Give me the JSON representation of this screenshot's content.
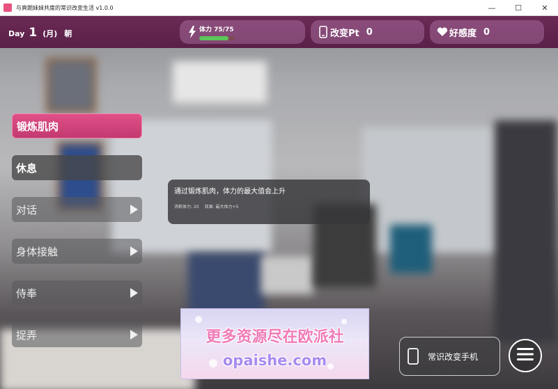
{
  "window": {
    "title": "与爽朗妹妹共度的常识改变生活 v1.0.0",
    "minimize_glyph": "—",
    "maximize_glyph": "☐",
    "close_glyph": "✕"
  },
  "hud": {
    "day_word": "Day",
    "day_number": "1",
    "weekday": "(月)",
    "time_of_day": "朝",
    "stamina": {
      "text": "体力 75/75",
      "current": 75,
      "max": 75,
      "fill_fraction": 0.8,
      "icon": "lightning-icon",
      "bar_color": "#5cc65a"
    },
    "points": {
      "label": "改变Pt",
      "value": "0",
      "icon": "phone-icon"
    },
    "favor": {
      "label": "好感度",
      "value": "0",
      "icon": "heart-icon"
    }
  },
  "menu": {
    "items": [
      {
        "label": "锻炼肌肉",
        "state": "active",
        "has_arrow": false
      },
      {
        "label": "休息",
        "state": "normal",
        "has_arrow": false
      },
      {
        "label": "对话",
        "state": "submenu",
        "has_arrow": true
      },
      {
        "label": "身体接触",
        "state": "submenu",
        "has_arrow": true
      },
      {
        "label": "侍奉",
        "state": "submenu",
        "has_arrow": true
      },
      {
        "label": "捉弄",
        "state": "submenu",
        "has_arrow": true
      }
    ]
  },
  "tooltip": {
    "description": "通过锻炼肌肉，体力的最大值会上升",
    "cost": "消耗体力: 20",
    "effect": "效果: 最大体力+5"
  },
  "watermark": {
    "line1": "更多资源尽在欧派社",
    "line2": "opaishe.com"
  },
  "phone_button": {
    "label": "常识改变手机",
    "icon": "smartphone-icon"
  },
  "menu_button": {
    "icon": "hamburger-menu-icon"
  },
  "colors": {
    "hud_bg": "#5a2048",
    "active_button": "#d2437c",
    "accent_pink": "#f07bb7"
  }
}
